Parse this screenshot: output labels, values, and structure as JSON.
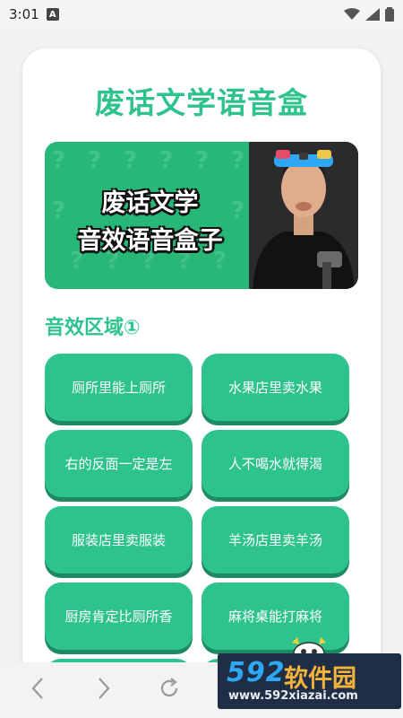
{
  "status": {
    "time": "3:01",
    "notif_badge": "A"
  },
  "app": {
    "title": "废话文学语音盒"
  },
  "banner": {
    "line1": "废话文学",
    "line2": "音效语音盒子",
    "accent": "#27b878"
  },
  "section": {
    "title": "音效区域①"
  },
  "buttons": [
    "厕所里能上厕所",
    "水果店里卖水果",
    "右的反面一定是左",
    "人不喝水就得渴",
    "服装店里卖服装",
    "羊汤店里卖羊汤",
    "厨房肯定比厕所香",
    "麻将桌能打麻将"
  ],
  "nav": {
    "back_icon": "back-icon",
    "forward_icon": "forward-icon",
    "reload_icon": "reload-icon"
  },
  "watermark": {
    "brand_num": "592",
    "brand_cn": "软件园",
    "url": "www.592xiazai.com"
  },
  "colors": {
    "accent": "#2ec28c",
    "button_shadow": "#1e8a62"
  }
}
